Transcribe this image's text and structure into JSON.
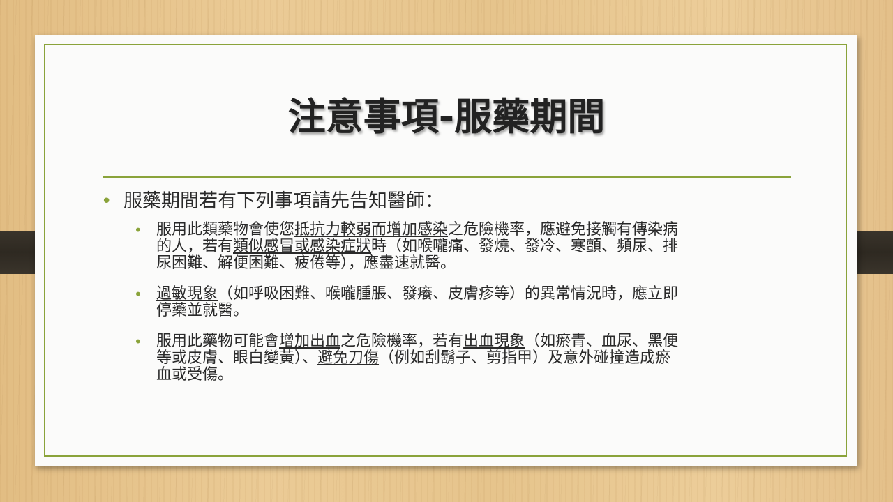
{
  "slide": {
    "title": "注意事項-服藥期間",
    "intro": "服藥期間若有下列事項請先告知醫師：",
    "bullet_glyph": "•",
    "items": [
      {
        "lines": [
          [
            "服用此類藥物會使您",
            "抵抗力較弱而增加感染",
            "之危險機率，應避免接觸有傳染病"
          ],
          [
            "的人，若有",
            "類似感冒或感染症狀",
            "時（如喉嚨痛、發燒、發冷、寒顫、頻尿、排"
          ],
          [
            "尿困難、解便困難、疲倦等），應盡速就醫。"
          ]
        ]
      },
      {
        "lines": [
          [
            "",
            "過敏現象",
            "（如呼吸困難、喉嚨腫脹、發癢、皮膚疹等）的異常情況時，應立即"
          ],
          [
            "停藥並就醫。"
          ]
        ]
      },
      {
        "lines": [
          [
            "服用此藥物可能會",
            "增加出血",
            "之危險機率，若有",
            "出血現象",
            "（如瘀青、血尿、黑便"
          ],
          [
            "等或皮膚、眼白變黃）、",
            "避免刀傷",
            "（例如刮鬍子、剪指甲）及意外碰撞造成瘀"
          ],
          [
            "血或受傷。"
          ]
        ]
      }
    ]
  }
}
